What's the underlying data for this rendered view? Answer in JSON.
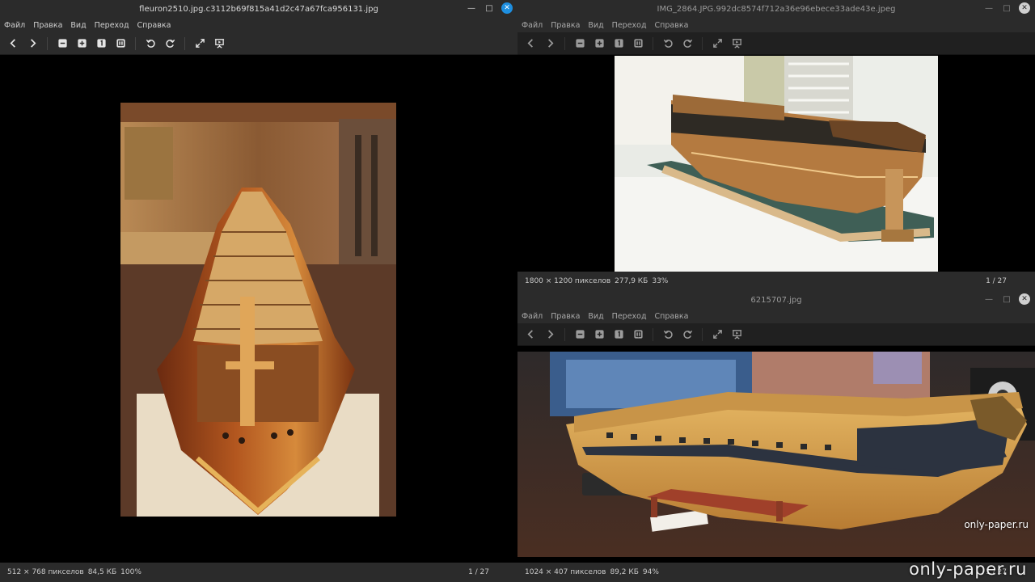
{
  "menu": [
    "Файл",
    "Правка",
    "Вид",
    "Переход",
    "Справка"
  ],
  "windows": {
    "left": {
      "title": "fleuron2510.jpg.c3112b69f815a41d2c47a67fca956131.jpg",
      "status": {
        "dimensions": "512 × 768 пикселов",
        "size": "84,5 КБ",
        "zoom": "100%",
        "counter": "1 / 27"
      }
    },
    "top_right": {
      "title": "IMG_2864.JPG.992dc8574f712a36e96ebece33ade43e.jpeg",
      "status": {
        "dimensions": "1800 × 1200 пикселов",
        "size": "277,9 КБ",
        "zoom": "33%",
        "counter": "1 / 27"
      }
    },
    "bottom_right": {
      "title": "6215707.jpg",
      "status": {
        "dimensions": "1024 × 407 пикселов",
        "size": "89,2 КБ",
        "zoom": "94%",
        "counter": "1 / 27"
      }
    }
  },
  "toolbar_icons": [
    "back-icon",
    "forward-icon",
    "zoom-out-icon",
    "zoom-in-icon",
    "zoom-original-icon",
    "zoom-fit-icon",
    "rotate-left-icon",
    "rotate-right-icon",
    "fullscreen-icon",
    "slideshow-icon"
  ],
  "watermarks": {
    "small": "only-paper.ru",
    "large": "only-paper.ru"
  },
  "colors": {
    "chrome": "#2b2b2b",
    "active_close": "#1e8fe0",
    "background": "#000000"
  }
}
